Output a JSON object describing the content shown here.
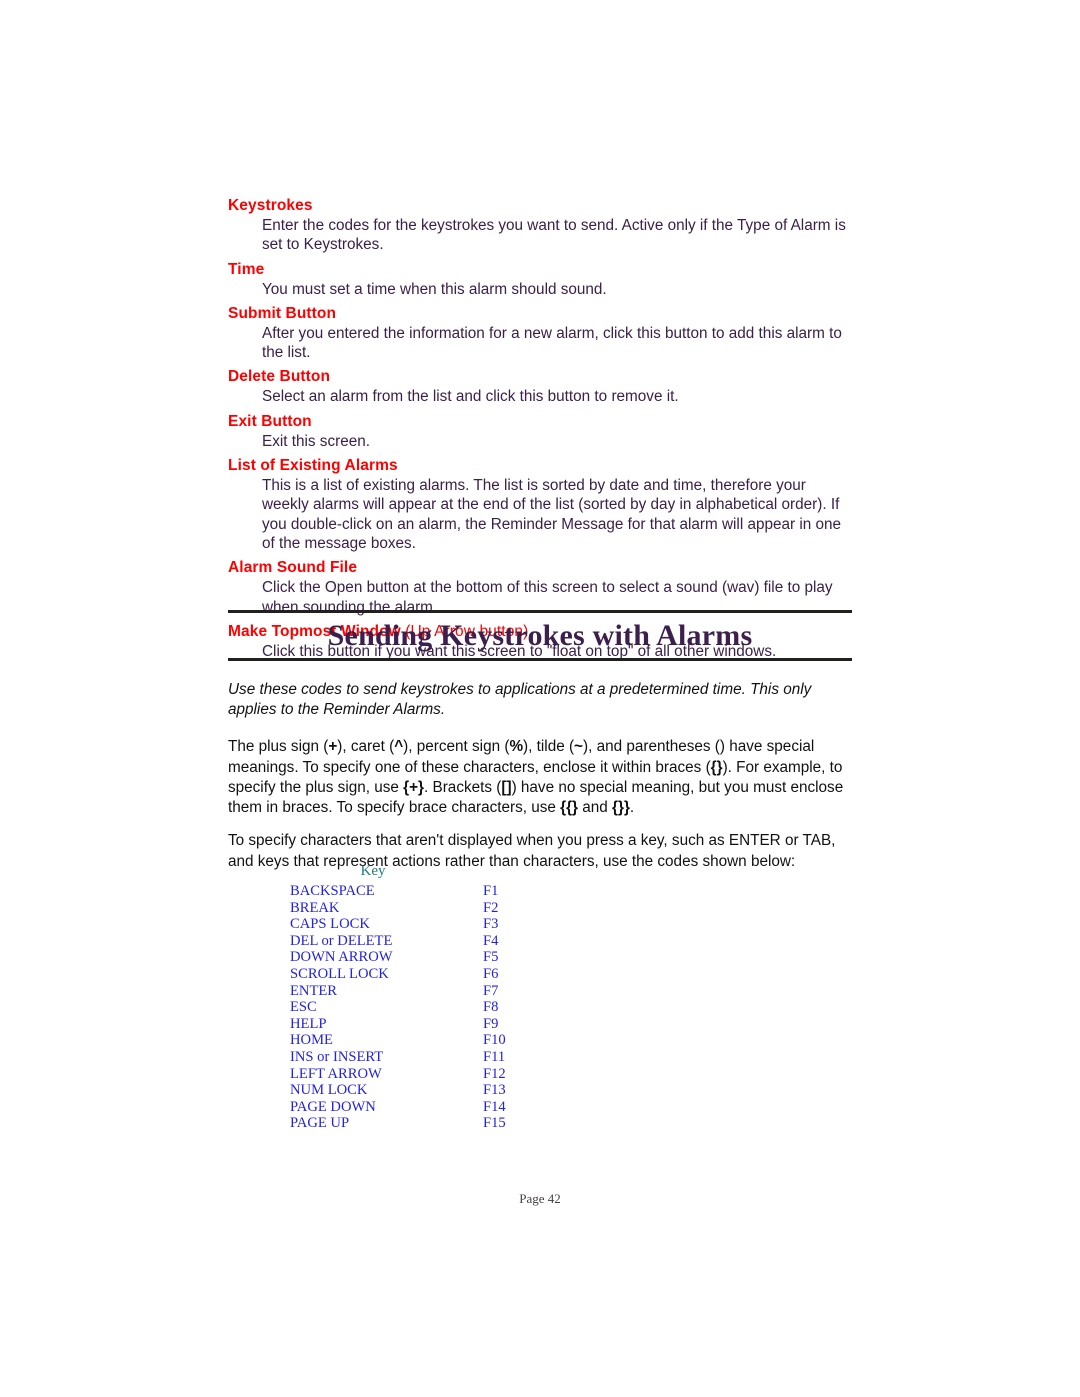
{
  "reference": {
    "entries": [
      {
        "term": "Keystrokes",
        "note": "",
        "description": "Enter the codes for the keystrokes you want to send.  Active only if the Type of Alarm is set to Keystrokes."
      },
      {
        "term": "Time",
        "note": "",
        "description": "You must set a time when this alarm should sound."
      },
      {
        "term": "Submit Button",
        "note": "",
        "description": "After you entered the information for a new alarm, click this button to add this alarm to the list."
      },
      {
        "term": "Delete Button",
        "note": "",
        "description": "Select an alarm from the list and click this button to remove it."
      },
      {
        "term": "Exit Button",
        "note": "",
        "description": "Exit this screen."
      },
      {
        "term": "List of Existing Alarms",
        "note": "",
        "description": "This is a list of existing alarms.  The list is sorted by date and time, therefore your weekly alarms will appear at the end of the list (sorted by day in alphabetical order).  If you double-click on an alarm, the Reminder Message for that alarm will appear in one of the message boxes."
      },
      {
        "term": "Alarm Sound File",
        "note": "",
        "description": "Click the Open button at the bottom of this screen to select a sound (wav) file to play when sounding the alarm."
      },
      {
        "term": "Make Topmost Window",
        "note": " (Up Arrow button)",
        "description": "Click this button if you want this screen to \"float on top\" of all other windows."
      }
    ]
  },
  "chapter": {
    "title": "Sending Keystrokes with Alarms"
  },
  "intro": {
    "italic_text": "Use these codes to send keystrokes to applications at a predetermined time.  This only applies to the Reminder Alarms."
  },
  "paragraphs": {
    "codes_line1_a": "The plus sign (",
    "codes_line1_b": "+",
    "codes_line1_c": "), caret (",
    "codes_line1_d": "^",
    "codes_line1_e": "), percent sign (",
    "codes_line1_f": "%",
    "codes_line1_g": "), tilde (",
    "codes_line1_h": "~",
    "codes_line1_i": "), and parentheses () have special meanings. To specify one of these characters, enclose it within braces (",
    "codes_line1_j": "{}",
    "codes_line1_k": "). For example, to specify the plus sign, use ",
    "codes_line1_l": "{+}",
    "codes_line1_m": ". Brackets (",
    "codes_line1_n": "[]",
    "codes_line1_o": ") have no special meaning, but you must enclose them in braces. To specify brace characters, use ",
    "codes_line1_p": "{{}",
    "codes_line1_q": " and ",
    "codes_line1_r": "{}}",
    "codes_line1_s": ".",
    "specify": "To specify characters that aren't displayed when you press a key, such as ENTER or TAB, and keys that represent actions rather than characters, use the codes shown below:"
  },
  "key_table": {
    "header": "Key",
    "rows": [
      {
        "name": "BACKSPACE",
        "fn": "F1"
      },
      {
        "name": "BREAK",
        "fn": "F2"
      },
      {
        "name": "CAPS LOCK",
        "fn": "F3"
      },
      {
        "name": "DEL or DELETE",
        "fn": "F4"
      },
      {
        "name": "DOWN ARROW",
        "fn": "F5"
      },
      {
        "name": "SCROLL LOCK",
        "fn": "F6"
      },
      {
        "name": "ENTER",
        "fn": "F7"
      },
      {
        "name": "ESC",
        "fn": "F8"
      },
      {
        "name": "HELP",
        "fn": "F9"
      },
      {
        "name": "HOME",
        "fn": "F10"
      },
      {
        "name": "INS or INSERT",
        "fn": "F11"
      },
      {
        "name": "LEFT ARROW",
        "fn": "F12"
      },
      {
        "name": "NUM LOCK",
        "fn": "F13"
      },
      {
        "name": "PAGE DOWN",
        "fn": "F14"
      },
      {
        "name": "PAGE UP",
        "fn": "F15"
      }
    ]
  },
  "footer": {
    "page_label": "Page 42"
  },
  "colors": {
    "term_red": "#ff0000",
    "body_purple": "#3b2048",
    "heading_purple": "#3c1f4c",
    "key_blue": "#2222e4",
    "key_header_teal": "#1f7f80",
    "rule_black": "#20201f",
    "footer_gray": "#44413f"
  }
}
